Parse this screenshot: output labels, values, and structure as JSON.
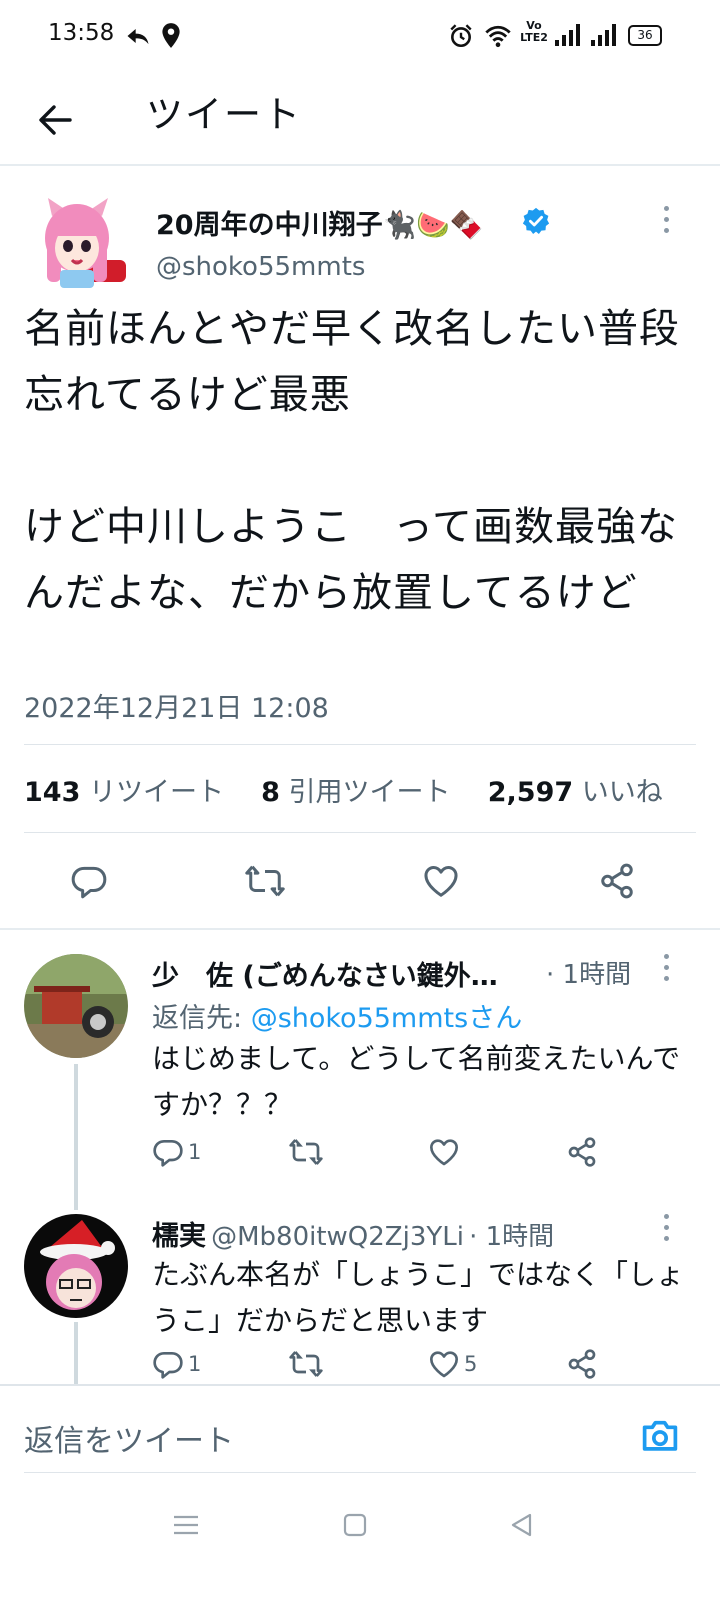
{
  "status_bar": {
    "time": "13:58",
    "battery": "36",
    "volte_label_top": "Vo",
    "volte_label_bottom": "LTE2"
  },
  "header": {
    "title": "ツイート"
  },
  "main_tweet": {
    "display_name": "20周年の中川翔子🐈‍⬛🍉🍫",
    "handle": "@shoko55mmts",
    "body": "名前ほんとやだ早く改名したい普段忘れてるけど最悪\n\nけど中川しようこ　って画数最強なんだよな、だから放置してるけど",
    "timestamp": "2022年12月21日 12:08",
    "retweets_count": "143",
    "retweets_label": "リツイート",
    "quotes_count": "8",
    "quotes_label": "引用ツイート",
    "likes_count": "2,597",
    "likes_label": "いいね"
  },
  "replies": [
    {
      "display_name": "少　佐 (ごめんなさい鍵外…",
      "time": "· 1時間",
      "reply_to_prefix": "返信先: ",
      "reply_to_handle": "@shoko55mmtsさん",
      "body": "はじめまして。どうして名前変えたいんですか？？？",
      "reply_count": "1",
      "retweet_count": "",
      "like_count": ""
    },
    {
      "display_name": "檽実",
      "handle": "@Mb80itwQ2Zj3YLi",
      "time": "· 1時間",
      "body": "たぶん本名が「しょうこ」ではなく「しょうこ」だからだと思います",
      "reply_count": "1",
      "retweet_count": "",
      "like_count": "5"
    }
  ],
  "compose": {
    "placeholder": "返信をツイート"
  },
  "colors": {
    "accent": "#1d9bf0",
    "muted": "#536471",
    "text": "#0f1419"
  }
}
